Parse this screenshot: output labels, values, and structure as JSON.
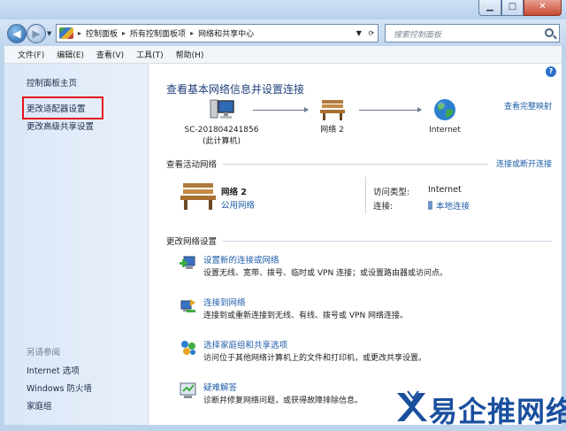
{
  "window": {
    "controls": {
      "minimize": "▁",
      "maximize": "□",
      "close": "✕"
    }
  },
  "navigation": {
    "breadcrumbs": [
      "控制面板",
      "所有控制面板项",
      "网络和共享中心"
    ],
    "search_placeholder": "搜索控制面板"
  },
  "menu": [
    "文件(F)",
    "编辑(E)",
    "查看(V)",
    "工具(T)",
    "帮助(H)"
  ],
  "sidebar": {
    "links": [
      "控制面板主页",
      "更改适配器设置",
      "更改高级共享设置"
    ],
    "see_also_heading": "另请参阅",
    "see_also": [
      "Internet 选项",
      "Windows 防火墙",
      "家庭组"
    ]
  },
  "main": {
    "title": "查看基本网络信息并设置连接",
    "full_map_link": "查看完整映射",
    "map_nodes": [
      {
        "label": "SC-201804241856",
        "sublabel": "(此计算机)",
        "icon": "computer-icon"
      },
      {
        "label": "网络  2",
        "sublabel": "",
        "icon": "bench-icon"
      },
      {
        "label": "Internet",
        "sublabel": "",
        "icon": "globe-icon"
      }
    ],
    "active_networks": {
      "heading": "查看活动网络",
      "link": "连接或断开连接",
      "network_name": "网络  2",
      "network_type": "公用网络",
      "access_type_key": "访问类型:",
      "access_type_value": "Internet",
      "connection_key": "连接:",
      "connection_value": "本地连接"
    },
    "change_settings": {
      "heading": "更改网络设置",
      "tasks": [
        {
          "title": "设置新的连接或网络",
          "description": "设置无线、宽带、拨号、临时或 VPN 连接；或设置路由器或访问点。",
          "icon": "new-connection-icon"
        },
        {
          "title": "连接到网络",
          "description": "连接到或重新连接到无线、有线、拨号或 VPN 网络连接。",
          "icon": "connect-network-icon"
        },
        {
          "title": "选择家庭组和共享选项",
          "description": "访问位于其他网络计算机上的文件和打印机，或更改共享设置。",
          "icon": "homegroup-icon"
        },
        {
          "title": "疑难解答",
          "description": "诊断并修复网络问题，或获得故障排除信息。",
          "icon": "troubleshoot-icon"
        }
      ]
    }
  },
  "watermark": {
    "text": "易企推网络"
  },
  "colors": {
    "link": "#1f5ea8",
    "title": "#1e3f7a",
    "highlight_box": "#e5141c",
    "sidebar": "#dbe6f6"
  }
}
